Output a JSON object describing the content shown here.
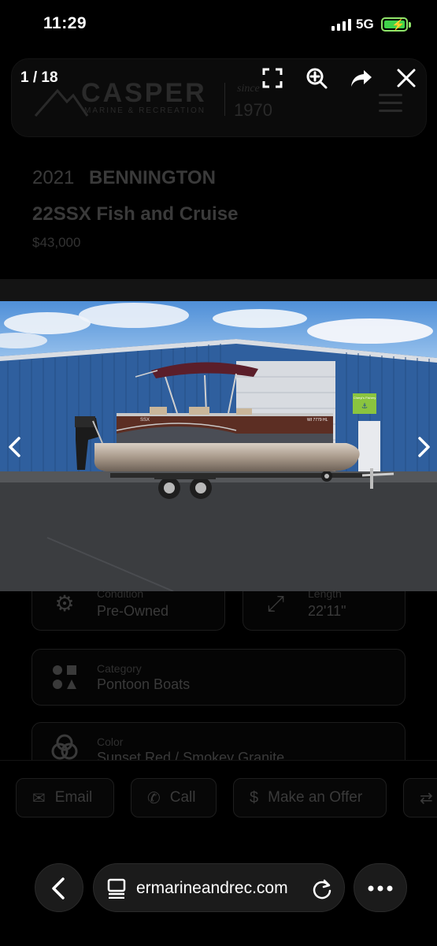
{
  "status": {
    "time": "11:29",
    "network": "5G"
  },
  "gallery": {
    "counter": "1 / 18"
  },
  "site": {
    "logo_name": "CASPER",
    "logo_tagline": "MARINE & RECREATION",
    "logo_since": "since",
    "logo_year": "1970"
  },
  "listing": {
    "year": "2021",
    "make": "BENNINGTON",
    "model": "22SSX Fish and Cruise",
    "price": "$43,000"
  },
  "specs": [
    {
      "label": "Condition",
      "value": "Pre-Owned",
      "icon": "gear-icon"
    },
    {
      "label": "Length",
      "value": "22'11\"",
      "icon": "ruler-icon"
    },
    {
      "label": "Category",
      "value": "Pontoon Boats",
      "icon": "shapes-icon"
    },
    {
      "label": "Color",
      "value": "Sunset Red / Smokey Granite",
      "icon": "color-circles-icon"
    }
  ],
  "actions": {
    "email": "Email",
    "call": "Call",
    "offer": "Make an Offer"
  },
  "photo": {
    "sign_text": "Cheryl's Fishery",
    "registration": "WI 7779 HL"
  },
  "browser": {
    "url": "ermarineandrec.com"
  },
  "colors": {
    "battery": "#3fd34a",
    "background": "#000000",
    "building": "#2f5f9e"
  }
}
